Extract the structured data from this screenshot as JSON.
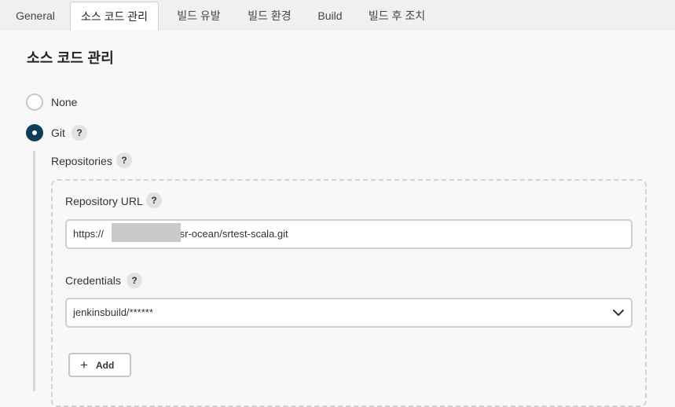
{
  "tabs": [
    {
      "label": "General"
    },
    {
      "label": "소스 코드 관리"
    },
    {
      "label": "빌드 유발"
    },
    {
      "label": "빌드 환경"
    },
    {
      "label": "Build"
    },
    {
      "label": "빌드 후 조치"
    }
  ],
  "active_tab": "소스 코드 관리",
  "section_title": "소스 코드 관리",
  "scm_options": [
    {
      "label": "None",
      "selected": false
    },
    {
      "label": "Git",
      "selected": true
    }
  ],
  "help_symbol": "?",
  "repositories": {
    "label": "Repositories",
    "repository_url": {
      "label": "Repository URL",
      "value_prefix": "https://",
      "value_suffix": "/sr-ocean/srtest-scala.git"
    },
    "credentials": {
      "label": "Credentials",
      "selected": "jenkinsbuild/******"
    },
    "add_button": {
      "label": "Add",
      "icon": "plus-icon"
    }
  },
  "colors": {
    "accent": "#0f3e5b",
    "tab_bar": "#f0f0f0",
    "background": "#f8f8f8"
  }
}
